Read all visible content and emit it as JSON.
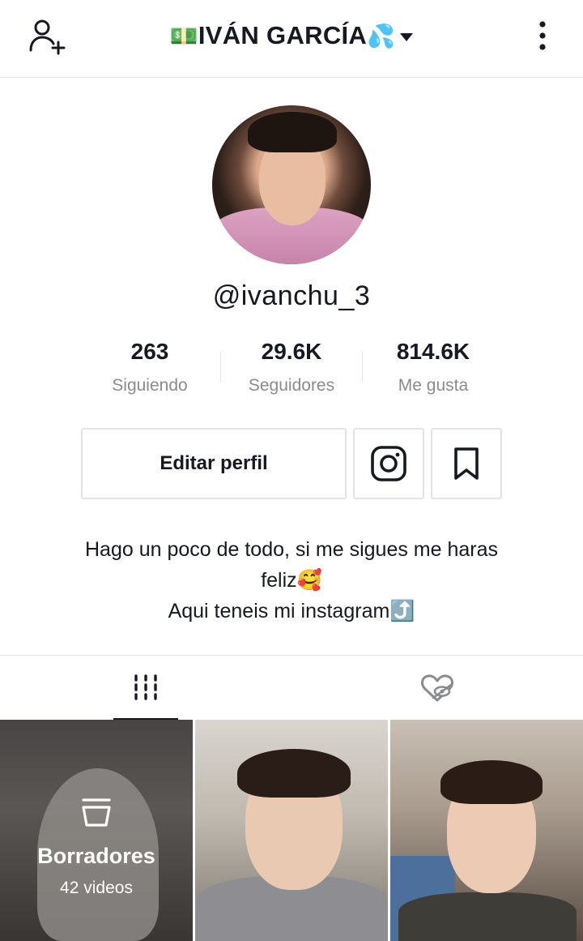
{
  "header": {
    "title_prefix": "💵",
    "title": "IVÁN GARCÍA",
    "title_suffix": "💦"
  },
  "profile": {
    "username": "@ivanchu_3"
  },
  "stats": [
    {
      "value": "263",
      "label": "Siguiendo"
    },
    {
      "value": "29.6K",
      "label": "Seguidores"
    },
    {
      "value": "814.6K",
      "label": "Me gusta"
    }
  ],
  "actions": {
    "edit_label": "Editar perfil"
  },
  "bio": {
    "line1": "Hago un poco de todo, si me sigues me haras",
    "line2_text": "feliz",
    "line2_emoji": "🥰",
    "line3_text": "Aqui teneis mi instagram",
    "line3_emoji": "⤴️"
  },
  "tabs": [
    {
      "name": "videos",
      "icon": "grid-icon",
      "active": true
    },
    {
      "name": "liked",
      "icon": "hidden-heart-icon",
      "active": false
    }
  ],
  "videos": [
    {
      "type": "drafts",
      "title": "Borradores",
      "count": "42 videos"
    },
    {
      "type": "video"
    },
    {
      "type": "video"
    }
  ]
}
